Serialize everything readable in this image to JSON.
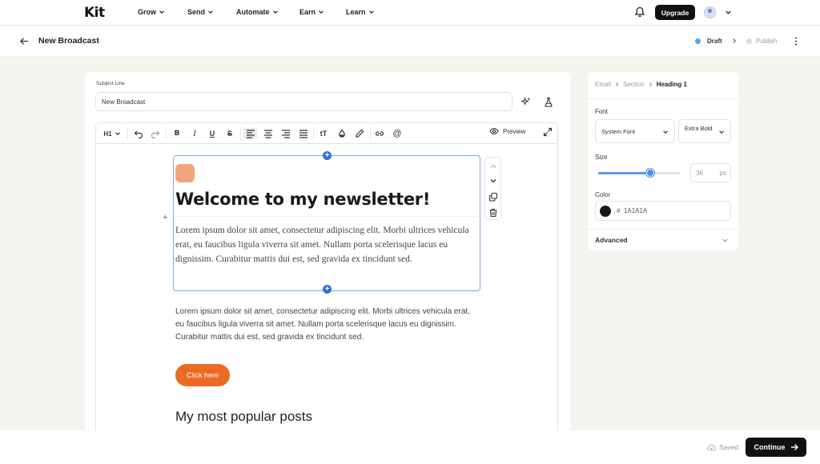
{
  "nav": {
    "logo": "Kit",
    "items": [
      "Grow",
      "Send",
      "Automate",
      "Earn",
      "Learn"
    ],
    "upgrade_label": "Upgrade"
  },
  "header": {
    "title": "New Broadcast",
    "steps": [
      {
        "label": "Draft",
        "status": "current"
      },
      {
        "label": "Publish",
        "status": "upcoming"
      }
    ]
  },
  "subject": {
    "label": "Subject Line",
    "value": "New Broadcast"
  },
  "toolbar": {
    "heading_level": "H1",
    "preview_label": "Preview"
  },
  "content": {
    "heading": "Welcome to my newsletter!",
    "serif_paragraph": "Lorem ipsum dolor sit amet, consectetur adipiscing elit. Morbi ultrices vehicula erat, eu faucibus ligula viverra sit amet. Nullam porta scelerisque lacus eu dignissim. Curabitur mattis dui est, sed gravida ex tincidunt sed.",
    "sans_paragraph": "Lorem ipsum dolor sit amet, consectetur adipiscing elit. Morbi ultrices vehicula erat, eu faucibus ligula viverra sit amet. Nullam porta scelerisque lacus eu dignissim. Curabitur mattis dui est, sed gravida ex tincidunt sed.",
    "cta_label": "Click here",
    "section_title": "My most popular posts",
    "accent_color": "#ed6a25",
    "logo_color": "#f0a57a"
  },
  "panel": {
    "breadcrumb": [
      "Email",
      "Section",
      "Heading 1"
    ],
    "font_label": "Font",
    "font_family": "System Font",
    "font_weight": "Extra Bold",
    "size_label": "Size",
    "size_value": "36",
    "size_unit": "px",
    "size_slider_fraction": 0.63,
    "color_label": "Color",
    "color_hash": "#",
    "color_hex": "1A1A1A",
    "color_swatch": "#1a1a1a",
    "advanced_label": "Advanced"
  },
  "footer": {
    "saved_label": "Saved",
    "continue_label": "Continue"
  }
}
